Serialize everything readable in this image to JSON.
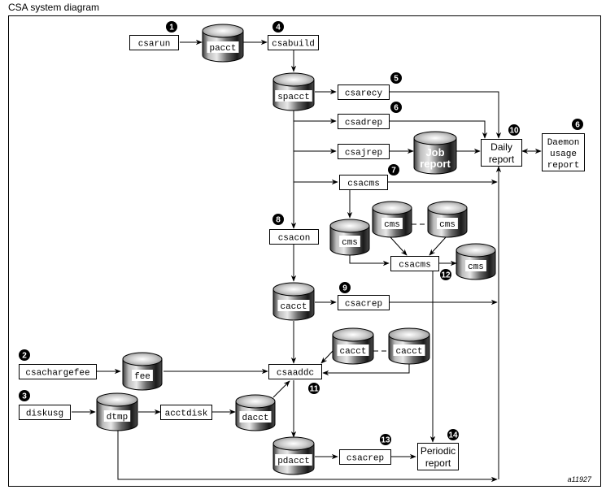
{
  "title": "CSA system diagram",
  "figure_id": "a11927",
  "processes": {
    "csarun": "csarun",
    "csabuild": "csabuild",
    "csarecy": "csarecy",
    "csadrep": "csadrep",
    "csajrep": "csajrep",
    "csacms_top": "csacms",
    "csacon": "csacon",
    "csacms_mid": "csacms",
    "csacrep_mid": "csacrep",
    "csachargefee": "csachargefee",
    "diskusg": "diskusg",
    "acctdisk": "acctdisk",
    "csaaddc": "csaaddc",
    "csacrep_bottom": "csacrep"
  },
  "files": {
    "pacct": "pacct",
    "spacct": "spacct",
    "job_report_line1": "Job",
    "job_report_line2": "report",
    "cms_left": "cms",
    "cms_top1": "cms",
    "cms_top2": "cms",
    "cms_right": "cms",
    "cacct_main": "cacct",
    "cacct_1": "cacct",
    "cacct_2": "cacct",
    "fee": "fee",
    "dtmp": "dtmp",
    "dacct": "dacct",
    "pdacct": "pdacct"
  },
  "reports": {
    "daily_line1": "Daily",
    "daily_line2": "report",
    "daemon_line1": "Daemon",
    "daemon_line2": "usage",
    "daemon_line3": "report",
    "periodic_line1": "Periodic",
    "periodic_line2": "report"
  },
  "badges": {
    "b1": "1",
    "b2": "2",
    "b3": "3",
    "b4": "4",
    "b5": "5",
    "b6a": "6",
    "b6b": "6",
    "b7": "7",
    "b8": "8",
    "b9": "9",
    "b10": "10",
    "b11": "11",
    "b12": "12",
    "b13": "13",
    "b14": "14"
  }
}
